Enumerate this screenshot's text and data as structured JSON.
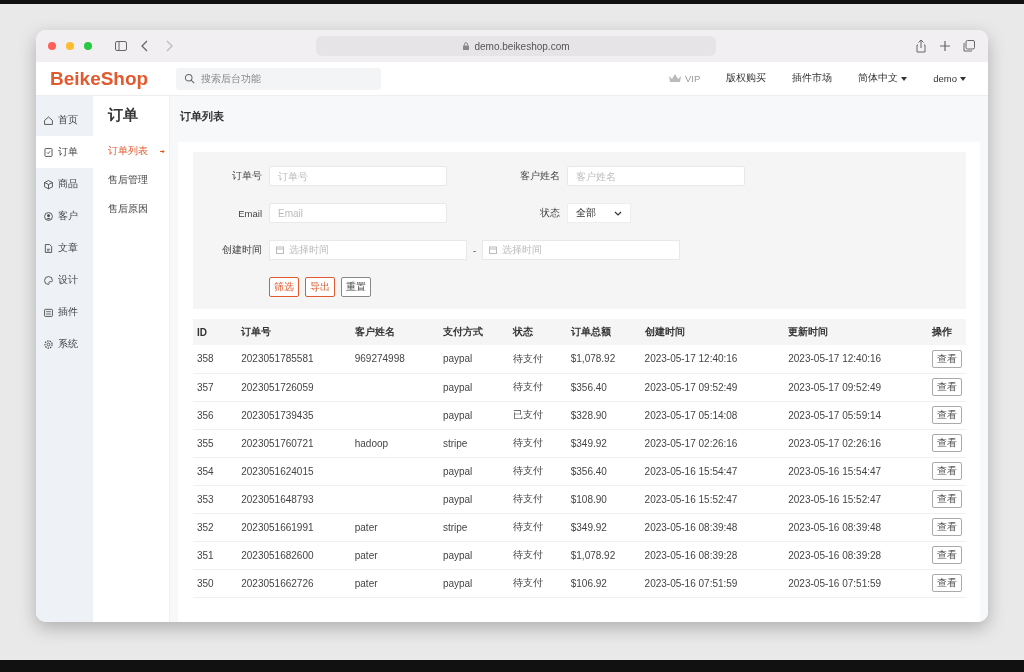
{
  "browser": {
    "url": "demo.beikeshop.com"
  },
  "header": {
    "logo": "BeikeShop",
    "search_placeholder": "搜索后台功能",
    "vip": "VIP",
    "links": [
      "版权购买",
      "插件市场"
    ],
    "language": "简体中文",
    "user": "demo"
  },
  "sidebar": {
    "items": [
      {
        "label": "首页",
        "selected": false
      },
      {
        "label": "订单",
        "selected": true
      },
      {
        "label": "商品",
        "selected": false
      },
      {
        "label": "客户",
        "selected": false
      },
      {
        "label": "文章",
        "selected": false
      },
      {
        "label": "设计",
        "selected": false
      },
      {
        "label": "插件",
        "selected": false
      },
      {
        "label": "系统",
        "selected": false
      }
    ]
  },
  "submenu": {
    "title": "订单",
    "items": [
      {
        "label": "订单列表",
        "selected": true
      },
      {
        "label": "售后管理",
        "selected": false
      },
      {
        "label": "售后原因",
        "selected": false
      }
    ]
  },
  "page_title": "订单列表",
  "filters": {
    "order_no": {
      "label": "订单号",
      "placeholder": "订单号"
    },
    "customer": {
      "label": "客户姓名",
      "placeholder": "客户姓名"
    },
    "email": {
      "label": "Email",
      "placeholder": "Email"
    },
    "status": {
      "label": "状态",
      "value": "全部"
    },
    "created": {
      "label": "创建时间",
      "start_placeholder": "选择时间",
      "separator": "-",
      "end_placeholder": "选择时间"
    },
    "buttons": [
      {
        "label": "筛选",
        "kind": "primary"
      },
      {
        "label": "导出",
        "kind": "primary"
      },
      {
        "label": "重置",
        "kind": "default"
      }
    ]
  },
  "table": {
    "columns": [
      "ID",
      "订单号",
      "客户姓名",
      "支付方式",
      "状态",
      "订单总额",
      "创建时间",
      "更新时间",
      "操作"
    ],
    "rows": [
      {
        "id": "358",
        "order_no": "2023051785581",
        "customer": "969274998",
        "payment": "paypal",
        "status": "待支付",
        "total": "$1,078.92",
        "created": "2023-05-17 12:40:16",
        "updated": "2023-05-17 12:40:16",
        "action": "查看"
      },
      {
        "id": "357",
        "order_no": "2023051726059",
        "customer": "",
        "payment": "paypal",
        "status": "待支付",
        "total": "$356.40",
        "created": "2023-05-17 09:52:49",
        "updated": "2023-05-17 09:52:49",
        "action": "查看"
      },
      {
        "id": "356",
        "order_no": "2023051739435",
        "customer": "",
        "payment": "paypal",
        "status": "已支付",
        "total": "$328.90",
        "created": "2023-05-17 05:14:08",
        "updated": "2023-05-17 05:59:14",
        "action": "查看"
      },
      {
        "id": "355",
        "order_no": "2023051760721",
        "customer": "hadoop",
        "payment": "stripe",
        "status": "待支付",
        "total": "$349.92",
        "created": "2023-05-17 02:26:16",
        "updated": "2023-05-17 02:26:16",
        "action": "查看"
      },
      {
        "id": "354",
        "order_no": "2023051624015",
        "customer": "",
        "payment": "paypal",
        "status": "待支付",
        "total": "$356.40",
        "created": "2023-05-16 15:54:47",
        "updated": "2023-05-16 15:54:47",
        "action": "查看"
      },
      {
        "id": "353",
        "order_no": "2023051648793",
        "customer": "",
        "payment": "paypal",
        "status": "待支付",
        "total": "$108.90",
        "created": "2023-05-16 15:52:47",
        "updated": "2023-05-16 15:52:47",
        "action": "查看"
      },
      {
        "id": "352",
        "order_no": "2023051661991",
        "customer": "pater",
        "payment": "stripe",
        "status": "待支付",
        "total": "$349.92",
        "created": "2023-05-16 08:39:48",
        "updated": "2023-05-16 08:39:48",
        "action": "查看"
      },
      {
        "id": "351",
        "order_no": "2023051682600",
        "customer": "pater",
        "payment": "paypal",
        "status": "待支付",
        "total": "$1,078.92",
        "created": "2023-05-16 08:39:28",
        "updated": "2023-05-16 08:39:28",
        "action": "查看"
      },
      {
        "id": "350",
        "order_no": "2023051662726",
        "customer": "pater",
        "payment": "paypal",
        "status": "待支付",
        "total": "$106.92",
        "created": "2023-05-16 07:51:59",
        "updated": "2023-05-16 07:51:59",
        "action": "查看"
      }
    ]
  }
}
